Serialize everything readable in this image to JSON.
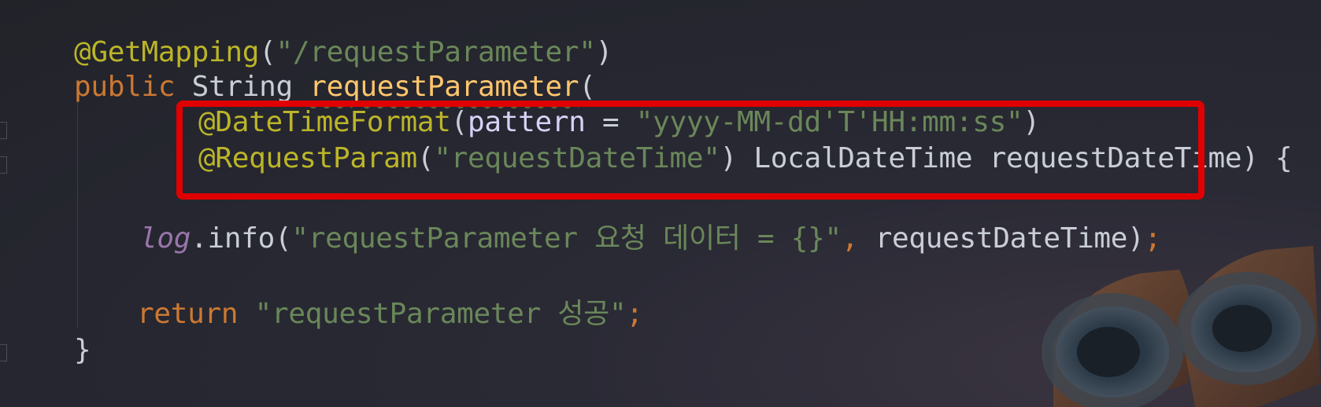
{
  "code": {
    "line1": {
      "annotation": "@GetMapping",
      "open": "(",
      "path": "\"/requestParameter\"",
      "close": ")"
    },
    "line2": {
      "keyword": "public",
      "type": "String",
      "method": "requestParameter",
      "open": "("
    },
    "line3": {
      "annotation": "@DateTimeFormat",
      "open": "(",
      "param_name": "pattern",
      "equals": " = ",
      "pattern": "\"yyyy-MM-dd'T'HH:mm:ss\"",
      "close": ")"
    },
    "line4": {
      "annotation": "@RequestParam",
      "open": "(",
      "name": "\"requestDateTime\"",
      "close": ")",
      "type": "LocalDateTime",
      "var": "requestDateTime",
      "end": ") {"
    },
    "line5": {
      "field": "log",
      "call": ".info(",
      "message": "\"requestParameter 요청 데이터 = {}\"",
      "comma": ",",
      "arg": " requestDateTime)",
      "semi": ";"
    },
    "line6": {
      "keyword": "return",
      "value": "\"requestParameter 성공\"",
      "semi": ";"
    },
    "line7": {
      "brace": "}"
    }
  },
  "colors": {
    "annotation": "#bbb529",
    "keyword": "#cc7832",
    "string": "#6a8759",
    "method": "#ffc66d",
    "parameter": "#d7d1f5",
    "field": "#9876aa",
    "highlight_border": "#e00000"
  },
  "decoration": {
    "icon": "robot-binocular-eyes-icon"
  }
}
